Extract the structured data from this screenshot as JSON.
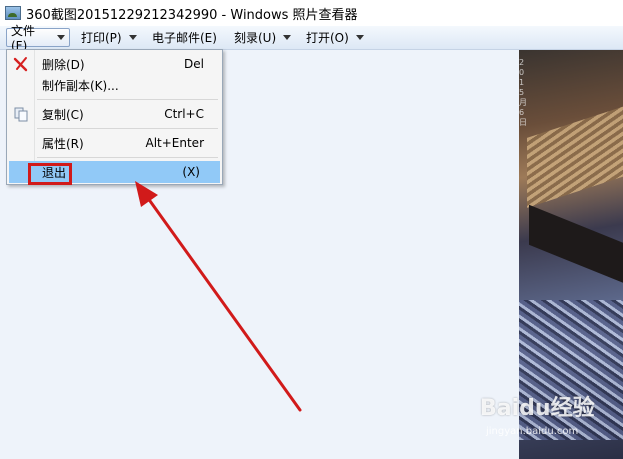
{
  "window": {
    "title": "360截图20151229212342990 - Windows 照片查看器"
  },
  "menubar": {
    "items": [
      {
        "label": "文件(F)"
      },
      {
        "label": "打印(P)"
      },
      {
        "label": "电子邮件(E)"
      },
      {
        "label": "刻录(U)"
      },
      {
        "label": "打开(O)"
      }
    ]
  },
  "file_menu": {
    "items": [
      {
        "label": "删除(D)",
        "shortcut": "Del",
        "icon": "delete-x-icon"
      },
      {
        "label": "制作副本(K)...",
        "shortcut": ""
      },
      {
        "label": "复制(C)",
        "shortcut": "Ctrl+C",
        "icon": "copy-icon"
      },
      {
        "label": "属性(R)",
        "shortcut": "Alt+Enter"
      },
      {
        "label": "退出",
        "shortcut": "(X)",
        "highlighted": true
      }
    ]
  },
  "annotation": {
    "box_color": "#d11a1a",
    "arrow_color": "#d11a1a"
  },
  "photo": {
    "side_text": "2015月6日",
    "watermark": "Baidu经验",
    "watermark_sub": "jingyan.baidu.com"
  },
  "colors": {
    "menu_highlight": "#91c9f7",
    "background": "#eef3fa"
  }
}
